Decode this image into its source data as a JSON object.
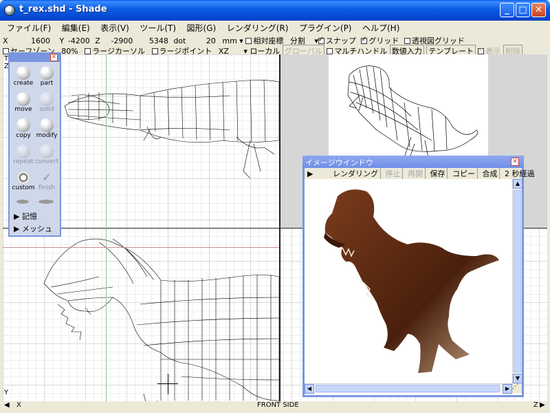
{
  "window": {
    "title": "t_rex.shd - Shade",
    "buttons": {
      "minimize": "_",
      "maximize": "□",
      "close": "✕"
    }
  },
  "menu": [
    "ファイル(F)",
    "編集(E)",
    "表示(V)",
    "ツール(T)",
    "図形(G)",
    "レンダリング(R)",
    "プラグイン(P)",
    "ヘルプ(H)"
  ],
  "status_row1": {
    "x_label": "X",
    "x_value": "1600",
    "y_label": "Y",
    "y_value": "-4200",
    "z_label": "Z",
    "z_value": "-2900",
    "size_value": "5348",
    "size_unit": "dot",
    "grid_value": "20",
    "grid_unit": "mm",
    "relative_coords": "相対座標",
    "divide": "分割",
    "snap": "スナップ",
    "grid": "グリッド",
    "transparent_grid": "透視図グリッド"
  },
  "status_row2": {
    "cursor_zone": "セーフゾーン",
    "zoom": "80%",
    "large_cursor": "ラージカーソル",
    "large_point": "ラージポイント",
    "xz": "XZ",
    "local": "ローカル",
    "global": "グローバル",
    "multi_handle": "マルチハンドル",
    "numeric_input": "数値入力",
    "template": "テンプレート",
    "display": "表示",
    "delete": "削除"
  },
  "toolbox": {
    "tools": [
      {
        "name": "create",
        "label": "create",
        "enabled": true
      },
      {
        "name": "part",
        "label": "part",
        "enabled": true
      },
      {
        "name": "move",
        "label": "move",
        "enabled": true
      },
      {
        "name": "solid",
        "label": "solid",
        "enabled": false
      },
      {
        "name": "copy",
        "label": "copy",
        "enabled": true
      },
      {
        "name": "modify",
        "label": "modify",
        "enabled": true
      },
      {
        "name": "repeat",
        "label": "repeat",
        "enabled": false
      },
      {
        "name": "convert",
        "label": "convert",
        "enabled": false
      },
      {
        "name": "custom",
        "label": "custom",
        "enabled": true
      },
      {
        "name": "finish",
        "label": "finish",
        "enabled": false
      }
    ],
    "memory": "記憶",
    "mesh": "メッシュ"
  },
  "image_window": {
    "title": "イメージウインドウ",
    "buttons": [
      "レンダリング",
      "停止",
      "再開",
      "保存",
      "コピー",
      "合成"
    ],
    "elapsed": "2 秒経過"
  },
  "views": {
    "bottom_label": "FRONT SIDE",
    "axis_x": "X",
    "axis_y": "Y",
    "axis_z": "Z",
    "axis_t": "T"
  },
  "colors": {
    "title_bar": "#0a5ae6",
    "palette_border": "#7a96df",
    "dino": "#5a2a12"
  }
}
